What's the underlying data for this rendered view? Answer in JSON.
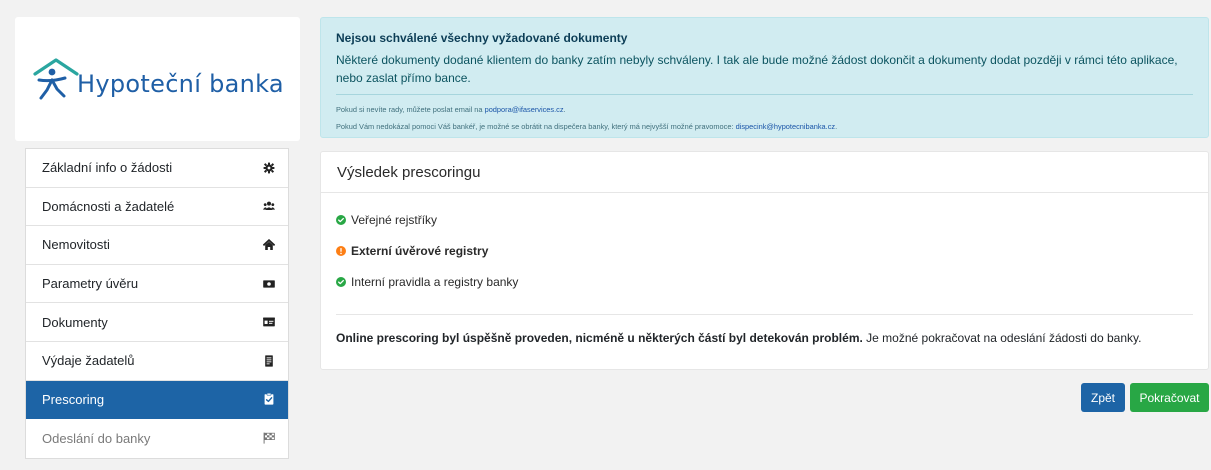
{
  "brand": {
    "logo_text": "Hypoteční banka",
    "color": "#1f5fa6"
  },
  "sidebar": {
    "items": [
      {
        "label": "Základní info o žádosti",
        "icon": "gear-icon",
        "state": "normal"
      },
      {
        "label": "Domácnosti a žadatelé",
        "icon": "users-icon",
        "state": "normal"
      },
      {
        "label": "Nemovitosti",
        "icon": "home-icon",
        "state": "normal"
      },
      {
        "label": "Parametry úvěru",
        "icon": "money-icon",
        "state": "normal"
      },
      {
        "label": "Dokumenty",
        "icon": "id-card-icon",
        "state": "normal"
      },
      {
        "label": "Výdaje žadatelů",
        "icon": "receipt-icon",
        "state": "normal"
      },
      {
        "label": "Prescoring",
        "icon": "clipboard-check-icon",
        "state": "active"
      },
      {
        "label": "Odeslání do banky",
        "icon": "flag-checkered-icon",
        "state": "disabled"
      }
    ],
    "active_color": "#1d64a6"
  },
  "alert": {
    "title": "Nejsou schválené všechny vyžadované dokumenty",
    "text": "Některé dokumenty dodané klientem do banky zatím nebyly schváleny. I tak ale bude možné žádost dokončit a dokumenty dodat později v rámci této aplikace, nebo zaslat přímo bance.",
    "help_prefix": "Pokud si nevíte rady, můžete poslat email na ",
    "help_email": "podpora@ifaservices.cz",
    "help_suffix": ".",
    "banker_prefix": "Pokud Vám nedokázal pomoci Váš bankéř, je možné se obrátit na dispečera banky, který má nejvyšší možné pravomoce: ",
    "banker_email": "dispecink@hypotecnibanka.cz",
    "banker_suffix": "."
  },
  "result_card": {
    "title": "Výsledek prescoringu",
    "checks": [
      {
        "label": "Veřejné rejstříky",
        "status": "ok"
      },
      {
        "label": "Externí úvěrové registry",
        "status": "warning"
      },
      {
        "label": "Interní pravidla a registry banky",
        "status": "ok"
      }
    ],
    "summary_bold": "Online prescoring byl úspěšně proveden, nicméně u některých částí byl detekován problém.",
    "summary_rest": " Je možné pokračovat na odeslání žádosti do banky.",
    "ok_color": "#28a745",
    "warning_color": "#fd7e14"
  },
  "actions": {
    "back_label": "Zpět",
    "next_label": "Pokračovat"
  }
}
